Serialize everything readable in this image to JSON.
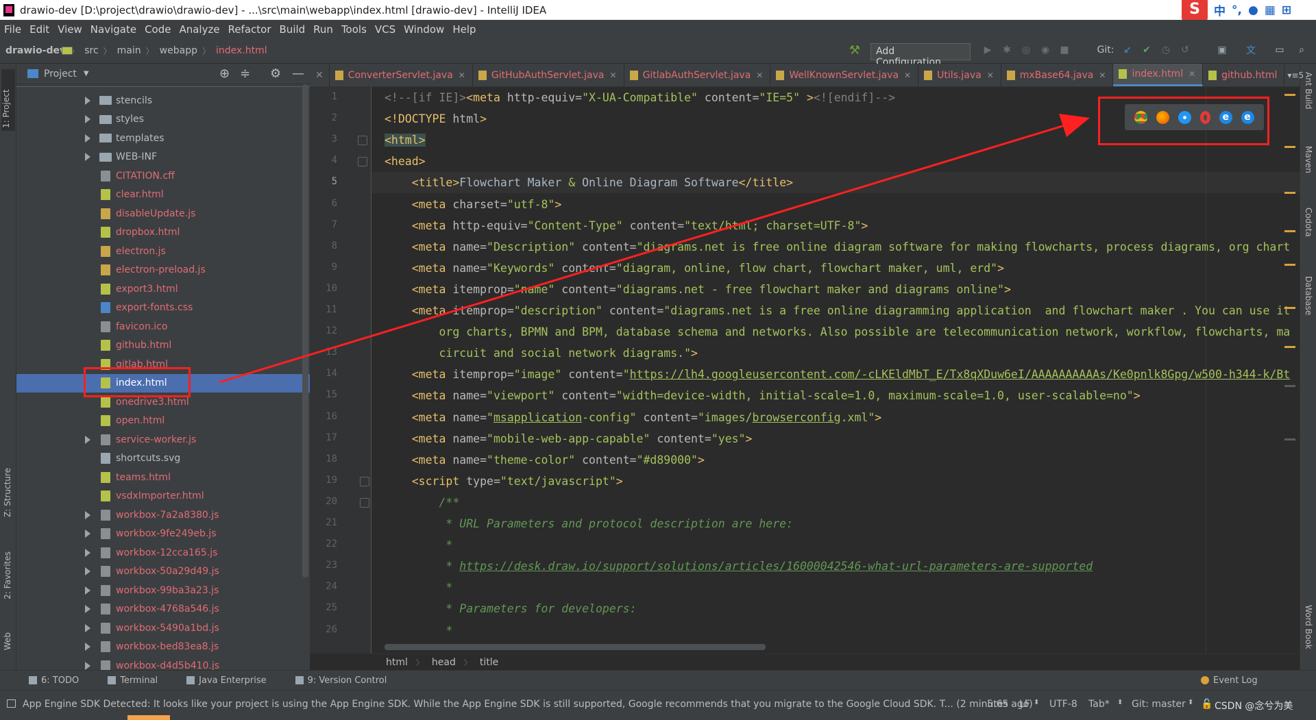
{
  "window": {
    "title": "drawio-dev [D:\\project\\drawio\\drawio-dev] - ...\\src\\main\\webapp\\index.html [drawio-dev] - IntelliJ IDEA",
    "ime": {
      "lang": "中",
      "punct": "°,"
    }
  },
  "menu": [
    "File",
    "Edit",
    "View",
    "Navigate",
    "Code",
    "Analyze",
    "Refactor",
    "Build",
    "Run",
    "Tools",
    "VCS",
    "Window",
    "Help"
  ],
  "breadcrumbs": [
    "drawio-dev",
    "src",
    "main",
    "webapp",
    "index.html"
  ],
  "toolbar": {
    "add_configuration": "Add Configuration...",
    "git_label": "Git:"
  },
  "project_panel": {
    "title": "Project",
    "items": [
      {
        "name": "stencils",
        "kind": "dir",
        "red": false
      },
      {
        "name": "styles",
        "kind": "dir",
        "red": false
      },
      {
        "name": "templates",
        "kind": "dir",
        "red": false
      },
      {
        "name": "WEB-INF",
        "kind": "dir",
        "red": false
      },
      {
        "name": "CITATION.cff",
        "kind": "gen",
        "red": true
      },
      {
        "name": "clear.html",
        "kind": "html",
        "red": true
      },
      {
        "name": "disableUpdate.js",
        "kind": "js",
        "red": true
      },
      {
        "name": "dropbox.html",
        "kind": "html",
        "red": true
      },
      {
        "name": "electron.js",
        "kind": "js",
        "red": true
      },
      {
        "name": "electron-preload.js",
        "kind": "js",
        "red": true
      },
      {
        "name": "export3.html",
        "kind": "html",
        "red": true
      },
      {
        "name": "export-fonts.css",
        "kind": "css",
        "red": true
      },
      {
        "name": "favicon.ico",
        "kind": "gen",
        "red": true
      },
      {
        "name": "github.html",
        "kind": "html",
        "red": true
      },
      {
        "name": "gitlab.html",
        "kind": "html",
        "red": true
      },
      {
        "name": "index.html",
        "kind": "html",
        "red": false,
        "selected": true
      },
      {
        "name": "onedrive3.html",
        "kind": "html",
        "red": true
      },
      {
        "name": "open.html",
        "kind": "html",
        "red": true
      },
      {
        "name": "service-worker.js",
        "kind": "wb",
        "red": true
      },
      {
        "name": "shortcuts.svg",
        "kind": "svg",
        "red": false
      },
      {
        "name": "teams.html",
        "kind": "html",
        "red": true
      },
      {
        "name": "vsdxImporter.html",
        "kind": "html",
        "red": true
      },
      {
        "name": "workbox-7a2a8380.js",
        "kind": "wb",
        "red": true
      },
      {
        "name": "workbox-9fe249eb.js",
        "kind": "wb",
        "red": true
      },
      {
        "name": "workbox-12cca165.js",
        "kind": "wb",
        "red": true
      },
      {
        "name": "workbox-50a29d49.js",
        "kind": "wb",
        "red": true
      },
      {
        "name": "workbox-99ba3a23.js",
        "kind": "wb",
        "red": true
      },
      {
        "name": "workbox-4768a546.js",
        "kind": "wb",
        "red": true
      },
      {
        "name": "workbox-5490a1bd.js",
        "kind": "wb",
        "red": true
      },
      {
        "name": "workbox-bed83ea8.js",
        "kind": "wb",
        "red": true
      },
      {
        "name": "workbox-d4d5b410.js",
        "kind": "wb",
        "red": true
      }
    ]
  },
  "tabs": [
    {
      "label": "ConverterServlet.java",
      "html": false
    },
    {
      "label": "GitHubAuthServlet.java",
      "html": false
    },
    {
      "label": "GitlabAuthServlet.java",
      "html": false
    },
    {
      "label": "WellKnownServlet.java",
      "html": false
    },
    {
      "label": "Utils.java",
      "html": false
    },
    {
      "label": "mxBase64.java",
      "html": false
    },
    {
      "label": "index.html",
      "html": true,
      "active": true
    },
    {
      "label": "github.html",
      "html": true
    }
  ],
  "tab_overflow": "5",
  "left_tool_tabs": [
    "1: Project",
    "Z: Structure",
    "2: Favorites",
    "Web"
  ],
  "right_tool_tabs": [
    "Ant Build",
    "Maven",
    "Codota",
    "Database",
    "Word Book"
  ],
  "editor": {
    "line_numbers": [
      "1",
      "2",
      "3",
      "4",
      "5",
      "6",
      "7",
      "8",
      "9",
      "10",
      "11",
      "12",
      "13",
      "14",
      "15",
      "16",
      "17",
      "18",
      "19",
      "20",
      "21",
      "22",
      "23",
      "24",
      "25",
      "26"
    ],
    "lines": [
      [
        {
          "c": "cmt",
          "t": "<!--[if IE]>"
        },
        {
          "c": "tag",
          "t": "<meta "
        },
        {
          "c": "attr",
          "t": "http-equiv="
        },
        {
          "c": "val",
          "t": "\"X-UA-Compatible\""
        },
        {
          "c": "attr",
          "t": " content="
        },
        {
          "c": "val",
          "t": "\"IE=5\""
        },
        {
          "c": "tag",
          "t": " >"
        },
        {
          "c": "cmt",
          "t": "<![endif]-->"
        }
      ],
      [
        {
          "c": "tag",
          "t": "<!DOCTYPE "
        },
        {
          "c": "attr",
          "t": "html"
        },
        {
          "c": "tag",
          "t": ">"
        }
      ],
      [
        {
          "c": "tag hl",
          "t": "<html>"
        }
      ],
      [
        {
          "c": "tag",
          "t": "<head>"
        }
      ],
      [
        {
          "c": "tag",
          "t": "    <title>"
        },
        {
          "c": "txt",
          "t": "Flowchart Maker "
        },
        {
          "c": "val",
          "t": "&"
        },
        {
          "c": "txt",
          "t": " Online Diagram Software"
        },
        {
          "c": "tag",
          "t": "</title>"
        }
      ],
      [
        {
          "c": "tag",
          "t": "    <meta "
        },
        {
          "c": "attr",
          "t": "charset="
        },
        {
          "c": "val",
          "t": "\"utf-8\""
        },
        {
          "c": "tag",
          "t": ">"
        }
      ],
      [
        {
          "c": "tag",
          "t": "    <meta "
        },
        {
          "c": "attr",
          "t": "http-equiv="
        },
        {
          "c": "val",
          "t": "\"Content-Type\""
        },
        {
          "c": "attr",
          "t": " content="
        },
        {
          "c": "val",
          "t": "\"text/html; charset=UTF-8\""
        },
        {
          "c": "tag",
          "t": ">"
        }
      ],
      [
        {
          "c": "tag",
          "t": "    <meta "
        },
        {
          "c": "attr",
          "t": "name="
        },
        {
          "c": "val",
          "t": "\"Description\""
        },
        {
          "c": "attr",
          "t": " content="
        },
        {
          "c": "val",
          "t": "\"diagrams.net is free online diagram software for making flowcharts, process diagrams, org chart"
        }
      ],
      [
        {
          "c": "tag",
          "t": "    <meta "
        },
        {
          "c": "attr",
          "t": "name="
        },
        {
          "c": "val",
          "t": "\"Keywords\""
        },
        {
          "c": "attr",
          "t": " content="
        },
        {
          "c": "val",
          "t": "\"diagram, online, flow chart, flowchart maker, uml, erd\""
        },
        {
          "c": "tag",
          "t": ">"
        }
      ],
      [
        {
          "c": "tag",
          "t": "    <meta "
        },
        {
          "c": "attr",
          "t": "itemprop="
        },
        {
          "c": "val",
          "t": "\"name\""
        },
        {
          "c": "attr",
          "t": " content="
        },
        {
          "c": "val",
          "t": "\"diagrams.net - free flowchart maker and diagrams online\""
        },
        {
          "c": "tag",
          "t": ">"
        }
      ],
      [
        {
          "c": "tag",
          "t": "    <meta "
        },
        {
          "c": "attr",
          "t": "itemprop="
        },
        {
          "c": "val",
          "t": "\"description\""
        },
        {
          "c": "attr",
          "t": " content="
        },
        {
          "c": "val",
          "t": "\"diagrams.net is a free online diagramming application  and flowchart maker . You can use it"
        }
      ],
      [
        {
          "c": "val",
          "t": "        org charts, BPMN and BPM, database schema and networks. Also possible are telecommunication network, workflow, flowcharts, ma"
        }
      ],
      [
        {
          "c": "val",
          "t": "        circuit and social network diagrams.\""
        },
        {
          "c": "tag",
          "t": ">"
        }
      ],
      [
        {
          "c": "tag",
          "t": "    <meta "
        },
        {
          "c": "attr",
          "t": "itemprop="
        },
        {
          "c": "val",
          "t": "\"image\""
        },
        {
          "c": "attr",
          "t": " content="
        },
        {
          "c": "val",
          "t": "\""
        },
        {
          "c": "val link",
          "t": "https://lh4.googleusercontent.com/-cLKEldMbT_E/Tx8qXDuw6eI/AAAAAAAAAAs/Ke0pnlk8Gpg/w500-h344-k/Bt"
        }
      ],
      [
        {
          "c": "tag",
          "t": "    <meta "
        },
        {
          "c": "attr",
          "t": "name="
        },
        {
          "c": "val",
          "t": "\"viewport\""
        },
        {
          "c": "attr",
          "t": " content="
        },
        {
          "c": "val",
          "t": "\"width=device-width, initial-scale=1.0, maximum-scale=1.0, user-scalable=no\""
        },
        {
          "c": "tag",
          "t": ">"
        }
      ],
      [
        {
          "c": "tag",
          "t": "    <meta "
        },
        {
          "c": "attr",
          "t": "name="
        },
        {
          "c": "val",
          "t": "\""
        },
        {
          "c": "val link",
          "t": "msapplication"
        },
        {
          "c": "val",
          "t": "-config\""
        },
        {
          "c": "attr",
          "t": " content="
        },
        {
          "c": "val",
          "t": "\"images/"
        },
        {
          "c": "val link",
          "t": "browserconfig"
        },
        {
          "c": "val",
          "t": ".xml\""
        },
        {
          "c": "tag",
          "t": ">"
        }
      ],
      [
        {
          "c": "tag",
          "t": "    <meta "
        },
        {
          "c": "attr",
          "t": "name="
        },
        {
          "c": "val",
          "t": "\"mobile-web-app-capable\""
        },
        {
          "c": "attr",
          "t": " content="
        },
        {
          "c": "val",
          "t": "\"yes\""
        },
        {
          "c": "tag",
          "t": ">"
        }
      ],
      [
        {
          "c": "tag",
          "t": "    <meta "
        },
        {
          "c": "attr",
          "t": "name="
        },
        {
          "c": "val",
          "t": "\"theme-color\""
        },
        {
          "c": "attr",
          "t": " content="
        },
        {
          "c": "val",
          "t": "\"#d89000\""
        },
        {
          "c": "tag",
          "t": ">"
        }
      ],
      [
        {
          "c": "tag",
          "t": "    <script "
        },
        {
          "c": "attr",
          "t": "type="
        },
        {
          "c": "val",
          "t": "\"text/javascript\""
        },
        {
          "c": "tag",
          "t": ">"
        }
      ],
      [
        {
          "c": "doc",
          "t": "        /**"
        }
      ],
      [
        {
          "c": "doc",
          "t": "         * URL Parameters and protocol description are here:"
        }
      ],
      [
        {
          "c": "doc",
          "t": "         *"
        }
      ],
      [
        {
          "c": "doc",
          "t": "         * "
        },
        {
          "c": "doc link",
          "t": "https://desk.draw.io/support/solutions/articles/16000042546-what-url-parameters-are-supported"
        }
      ],
      [
        {
          "c": "doc",
          "t": "         *"
        }
      ],
      [
        {
          "c": "doc",
          "t": "         * Parameters for developers:"
        }
      ],
      [
        {
          "c": "doc",
          "t": "         *"
        }
      ]
    ]
  },
  "editor_breadcrumb": [
    "html",
    "head",
    "title"
  ],
  "bottom_tools": [
    "6: TODO",
    "Terminal",
    "Java Enterprise",
    "9: Version Control"
  ],
  "event_log": "Event Log",
  "status": {
    "message": "App Engine SDK Detected: It looks like your project is using the App Engine SDK. While the App Engine SDK is still supported, Google recommends that you migrate to the Google Cloud SDK. T... (2 minutes ago)",
    "position": "5:65",
    "line_sep": "LF",
    "encoding": "UTF-8",
    "indent": "Tab*",
    "git": "Git: master",
    "watermark": "CSDN @念兮为美"
  },
  "colors": {
    "selection": "#4b6eaf",
    "annotation": "#ff2020",
    "accent": "#f5a24a"
  },
  "browser_icons": [
    "chrome-icon",
    "firefox-icon",
    "safari-icon",
    "opera-icon",
    "ie-icon",
    "edge-icon"
  ]
}
